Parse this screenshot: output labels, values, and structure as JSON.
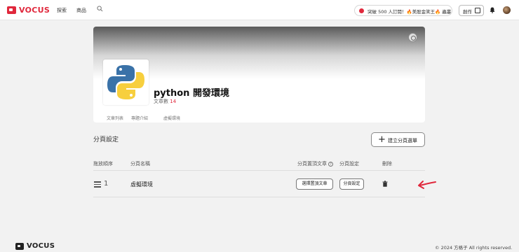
{
  "nav": {
    "brand": "VOCUS",
    "links": [
      "探索",
      "商品"
    ],
    "promo_text": "突破 500 人訂閱！🔥美股金笑王🔥 蟲叢...",
    "create_label": "創作"
  },
  "card": {
    "title": "python 開發環境",
    "count_label": "文章數",
    "count_value": "14",
    "tabs": [
      "文章列表",
      "專題介紹",
      "虛擬環境"
    ]
  },
  "section": {
    "title": "分頁設定",
    "add_button": "建立分頁選單"
  },
  "table": {
    "headers": {
      "order": "拖放順序",
      "name": "分頁名稱",
      "pinned": "分頁置頂文章",
      "settings": "分頁設定",
      "delete": "刪除"
    },
    "rows": [
      {
        "order": "1",
        "name": "虛擬環境",
        "pin_button": "選擇置頂文章",
        "settings_button": "分頁設定"
      }
    ]
  },
  "footer": {
    "brand": "VOCUS",
    "copyright": "© 2024 方格子 All rights reserved."
  },
  "colors": {
    "brand_red": "#e0283c",
    "background": "#f2f2f2"
  },
  "icons": [
    "search-icon",
    "pen-icon",
    "bell-icon",
    "gear-icon",
    "plus-icon",
    "help-icon",
    "drag-handle-icon",
    "trash-icon",
    "red-arrow-icon"
  ]
}
